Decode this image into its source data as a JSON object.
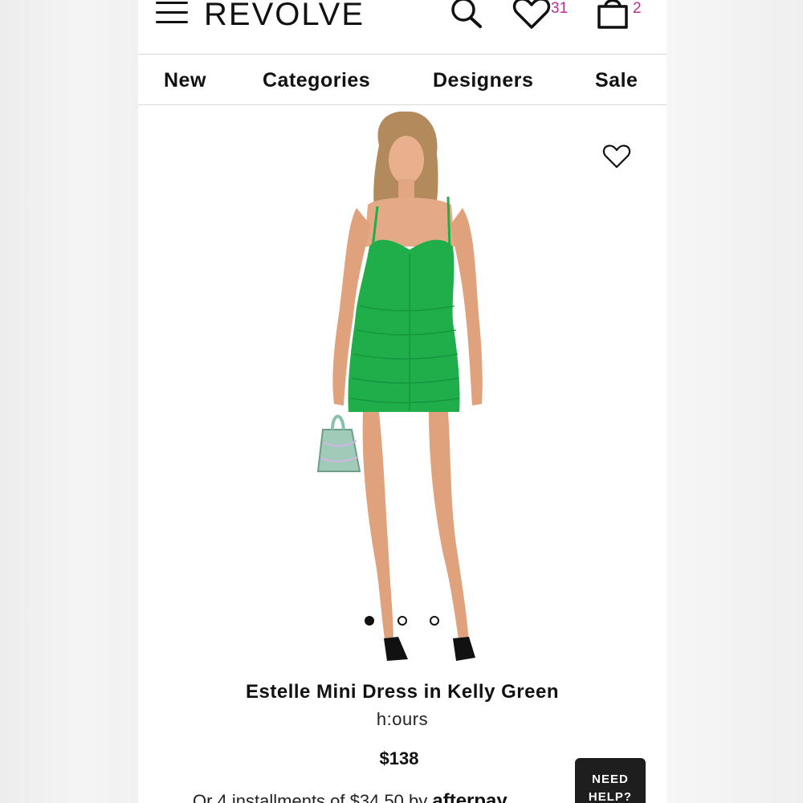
{
  "header": {
    "logo": "REVOLVE",
    "wishlist_count": "31",
    "bag_count": "2"
  },
  "nav": {
    "items": [
      "New",
      "Categories",
      "Designers",
      "Sale"
    ]
  },
  "product": {
    "name": "Estelle Mini Dress in Kelly Green",
    "brand": "h:ours",
    "price": "$138",
    "installments_prefix": "Or 4 installments of $34.50 by ",
    "installments_provider": "afterpay",
    "image_count": 3,
    "active_image_index": 0,
    "dress_color": "#1fae4a"
  },
  "help": {
    "line1": "NEED",
    "line2": "HELP?"
  },
  "colors": {
    "accent": "#b5328e",
    "text": "#111111"
  }
}
